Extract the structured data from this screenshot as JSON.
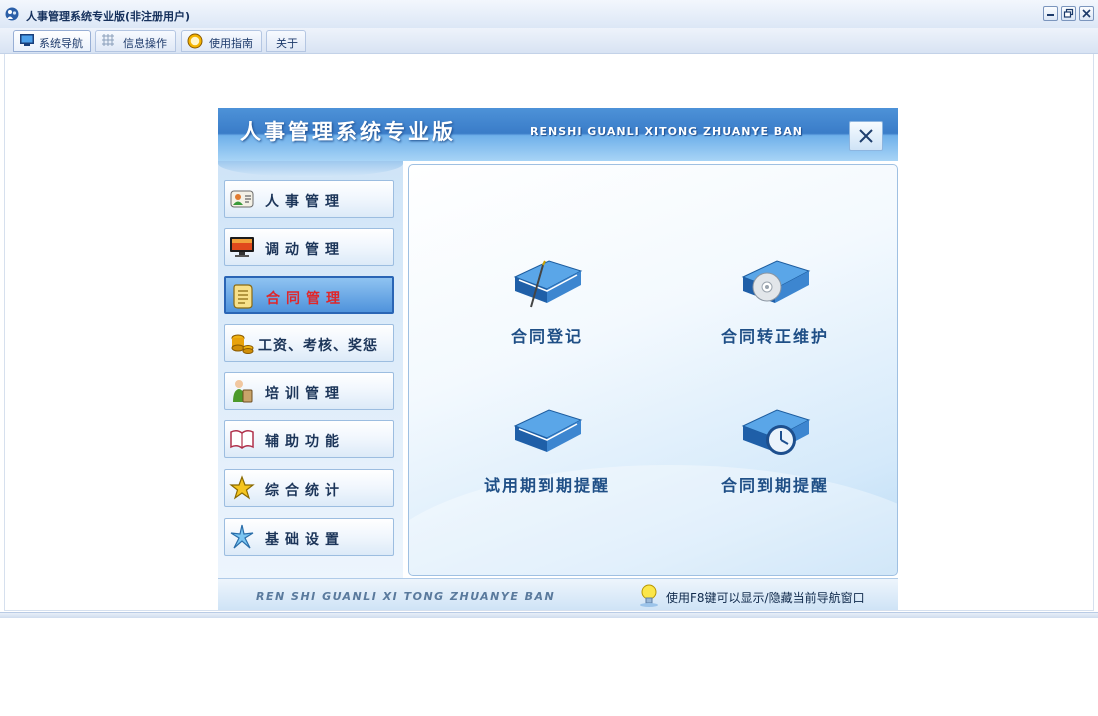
{
  "window": {
    "title": "人事管理系统专业版(非注册用户)",
    "buttons": [
      "minimize-icon",
      "restore-icon",
      "close-icon"
    ]
  },
  "menubar": {
    "tabs": [
      {
        "label": "系统导航",
        "icon": "monitor-icon",
        "active": true
      },
      {
        "label": "信息操作",
        "icon": "grid-icon",
        "active": false
      },
      {
        "label": "使用指南",
        "icon": "help-circle-icon",
        "active": false
      },
      {
        "label": "关于",
        "icon": "",
        "active": false
      }
    ]
  },
  "nav": {
    "title_cn": "人事管理系统专业版",
    "title_en": "RENSHI GUANLI XITONG ZHUANYE BAN",
    "sidebar": [
      {
        "label": "人事管理",
        "icon": "contact-card-icon",
        "active": false
      },
      {
        "label": "调动管理",
        "icon": "monitor-icon",
        "active": false
      },
      {
        "label": "合同管理",
        "icon": "document-icon",
        "active": true
      },
      {
        "label": "工资、考核、奖惩",
        "icon": "coins-icon",
        "active": false
      },
      {
        "label": "培训管理",
        "icon": "trainee-icon",
        "active": false
      },
      {
        "label": "辅助功能",
        "icon": "book-icon",
        "active": false
      },
      {
        "label": "综合统计",
        "icon": "star-icon",
        "active": false
      },
      {
        "label": "基础设置",
        "icon": "sparkle-icon",
        "active": false
      }
    ],
    "functions": [
      {
        "label": "合同登记",
        "icon": "book-pen-icon"
      },
      {
        "label": "合同转正维护",
        "icon": "book-disc-icon"
      },
      {
        "label": "试用期到期提醒",
        "icon": "book-icon"
      },
      {
        "label": "合同到期提醒",
        "icon": "book-clock-icon"
      }
    ],
    "footer_en": "REN SHI GUANLI XI TONG ZHUANYE BAN",
    "footer_hint": "使用F8键可以显示/隐藏当前导航窗口"
  },
  "colors": {
    "header_blue": "#3a7cc8",
    "active_text": "#e0262a",
    "label_blue": "#1f4f86"
  }
}
